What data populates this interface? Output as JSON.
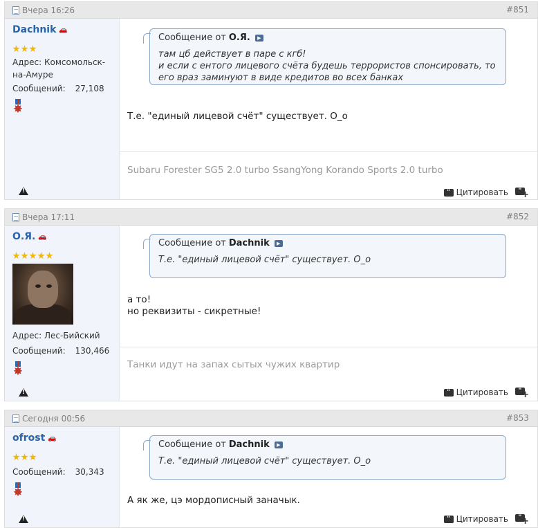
{
  "posts": [
    {
      "date": "Вчера 16:26",
      "number": "#851",
      "user": {
        "name": "Dachnik",
        "stars": 3,
        "address": "Адрес: Комсомольск-на-Амуре",
        "messages_label": "Сообщений:",
        "messages_count": "27,108"
      },
      "quote": {
        "prefix": "Сообщение от",
        "author": "О.Я.",
        "text": "там цб действует в паре с кгб!\nи если с ентого лицевого счёта будешь террористов спонсировать, то его враз заминуют в виде кредитов во всех банках"
      },
      "message": "Т.е. \"единый лицевой счёт\" существует. О_о",
      "signature": "Subaru Forester SG5 2.0 turbo SsangYong Korando Sports 2.0 turbo",
      "quote_button": "Цитировать"
    },
    {
      "date": "Вчера 17:11",
      "number": "#852",
      "user": {
        "name": "О.Я.",
        "stars": 5,
        "address": "Адрес: Лес-Бийский",
        "messages_label": "Сообщений:",
        "messages_count": "130,466"
      },
      "quote": {
        "prefix": "Сообщение от",
        "author": "Dachnik",
        "text": "Т.е. \"единый лицевой счёт\" существует. О_о"
      },
      "message": "а то!\nно реквизиты - сикретные!",
      "signature": "Танки идут на запах сытых чужих квартир",
      "quote_button": "Цитировать"
    },
    {
      "date": "Сегодня 00:56",
      "number": "#853",
      "user": {
        "name": "ofrost",
        "stars": 3,
        "messages_label": "Сообщений:",
        "messages_count": "30,343"
      },
      "quote": {
        "prefix": "Сообщение от",
        "author": "Dachnik",
        "text": "Т.е. \"единый лицевой счёт\" существует. О_о"
      },
      "message": "А як же, цэ мордописный заначык.",
      "quote_button": "Цитировать"
    }
  ]
}
